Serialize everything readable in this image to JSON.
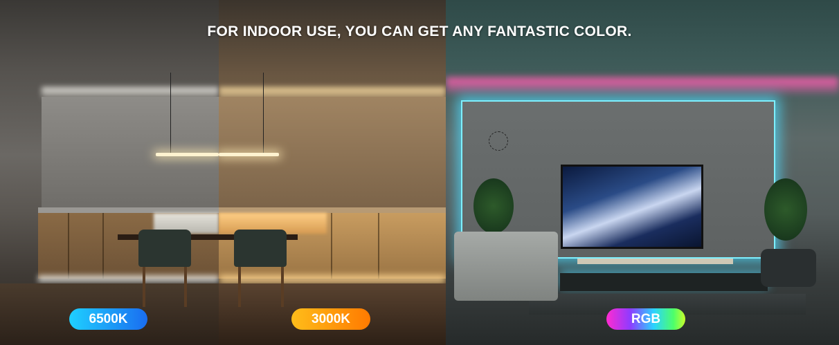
{
  "headline": "FOR INDOOR USE, YOU CAN GET ANY FANTASTIC COLOR.",
  "labels": {
    "cool": "6500K",
    "warm": "3000K",
    "rgb": "RGB"
  },
  "colors": {
    "cool_pill": [
      "#1fd0ff",
      "#1a6df0"
    ],
    "warm_pill": [
      "#ffbd1a",
      "#ff7a00"
    ],
    "rgb_pill": [
      "#ff2bd0",
      "#8f3bff",
      "#2bd3ff",
      "#4dff6a",
      "#c8ff2b"
    ],
    "cool_light": "#e8e6e0",
    "warm_light": "#f7d9a1",
    "rgb_top_light": "#ff5fb0",
    "rgb_backlight": "#7ef0ff"
  }
}
